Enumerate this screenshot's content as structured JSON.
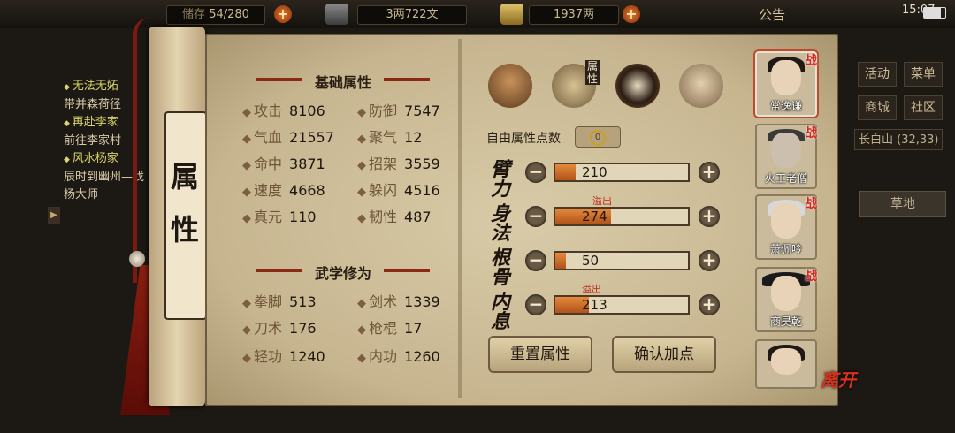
{
  "topbar": {
    "bag_label": "储存",
    "bag_value": "54/280",
    "money_value": "3两722文",
    "silver_value": "1937两",
    "notice": "公告",
    "time": "15:07"
  },
  "quest_panel": {
    "items": [
      {
        "head": "无法无妬",
        "desc": "带并森荷径"
      },
      {
        "head": "再赴李家",
        "desc": "前往李家村"
      },
      {
        "head": "风水杨家",
        "desc": "辰时到幽州—找杨大师"
      }
    ]
  },
  "scroll_title": [
    "属",
    "性"
  ],
  "basic": {
    "title": "基础属性",
    "stats": [
      {
        "name": "攻击",
        "value": "8106"
      },
      {
        "name": "防御",
        "value": "7547"
      },
      {
        "name": "气血",
        "value": "21557"
      },
      {
        "name": "聚气",
        "value": "12"
      },
      {
        "name": "命中",
        "value": "3871"
      },
      {
        "name": "招架",
        "value": "3559"
      },
      {
        "name": "速度",
        "value": "4668"
      },
      {
        "name": "躲闪",
        "value": "4516"
      },
      {
        "name": "真元",
        "value": "110"
      },
      {
        "name": "韧性",
        "value": "487"
      }
    ]
  },
  "martial": {
    "title": "武学修为",
    "stats": [
      {
        "name": "拳脚",
        "value": "513"
      },
      {
        "name": "剑术",
        "value": "1339"
      },
      {
        "name": "刀术",
        "value": "176"
      },
      {
        "name": "枪棍",
        "value": "17"
      },
      {
        "name": "轻功",
        "value": "1240"
      },
      {
        "name": "内功",
        "value": "1260"
      }
    ]
  },
  "tabs": {
    "attr_label": "属性"
  },
  "points": {
    "label": "自由属性点数",
    "value": "0",
    "rows": [
      {
        "label": "臂力",
        "value": "210",
        "fill": 0.15,
        "overflow": ""
      },
      {
        "label": "身法",
        "value": "274",
        "fill": 0.42,
        "overflow": "溢出"
      },
      {
        "label": "根骨",
        "value": "50",
        "fill": 0.08,
        "overflow": ""
      },
      {
        "label": "内息",
        "value": "213",
        "fill": 0.25,
        "overflow": "溢出"
      }
    ]
  },
  "buttons": {
    "reset": "重置属性",
    "confirm": "确认加点"
  },
  "party": {
    "war_tag": "战",
    "members": [
      {
        "name": "常逸谦"
      },
      {
        "name": "火工老僧"
      },
      {
        "name": "萧佩吟"
      },
      {
        "name": "商昊乾"
      },
      {
        "name": ""
      }
    ],
    "leave": "离开"
  },
  "right_menu": {
    "items": [
      "活动",
      "菜单",
      "商城",
      "社区"
    ],
    "location": "长白山  (32,33)",
    "grass": "草地"
  },
  "colors": {
    "accent": "#c0281a",
    "paper": "#cdbd98",
    "bar_fill": "#e58a3c"
  }
}
